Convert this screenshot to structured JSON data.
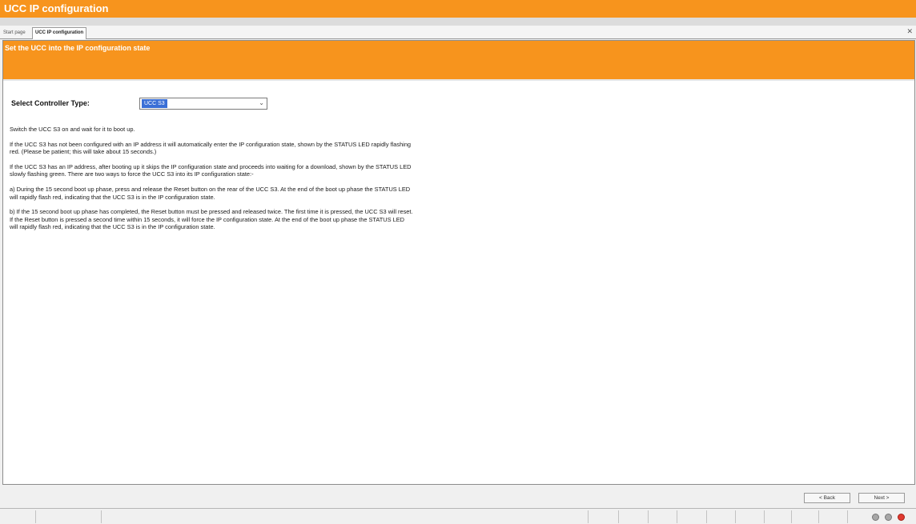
{
  "window": {
    "title": "UCC IP configuration"
  },
  "tabs": [
    {
      "label": "Start page",
      "active": false
    },
    {
      "label": "UCC IP configuration",
      "active": true
    }
  ],
  "tab_close_icon": "close-icon",
  "banner": {
    "title": "Set the UCC into the IP configuration state"
  },
  "controller": {
    "label": "Select Controller Type:",
    "selected": "UCC S3"
  },
  "paragraphs": [
    "Switch the UCC S3 on and wait for it to boot up.",
    "If the UCC S3 has not been configured with an IP address it will automatically enter the IP configuration state, shown by the STATUS LED rapidly flashing red.  (Please be patient; this will take about 15 seconds.)",
    "If the UCC S3 has an IP address, after booting up it skips the IP configuration state and proceeds into waiting for a download, shown by the STATUS LED slowly flashing green.  There are two ways to force the UCC S3 into its IP configuration state:-",
    "a) During the 15 second boot up phase, press and release the Reset button on the rear of the UCC S3.   At the end of the boot up phase the STATUS LED will rapidly flash red, indicating that the UCC S3 is in the IP configuration state.",
    "b) If the 15 second boot up phase has completed, the Reset button must be pressed and released twice.  The first time it is pressed, the UCC S3 will reset.  If the Reset button is pressed a second time within 15 seconds, it will force the IP configuration state.  At the end of the boot up phase the STATUS LED will rapidly flash red, indicating that the UCC S3 is in the IP configuration state."
  ],
  "buttons": {
    "back": "< Back",
    "next": "Next >"
  },
  "colors": {
    "brand_orange": "#f7941d",
    "selection_blue": "#3a6fd6",
    "status_red": "#e0392f",
    "status_grey": "#a7a7a7"
  }
}
